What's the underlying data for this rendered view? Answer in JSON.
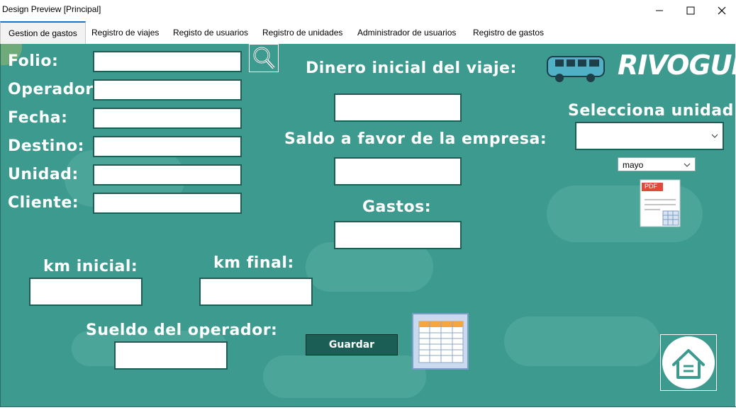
{
  "window": {
    "title": "Design Preview [Principal]"
  },
  "tabs": [
    {
      "label": "Gestion de gastos"
    },
    {
      "label": "Registro de viajes"
    },
    {
      "label": "Registo de usuarios"
    },
    {
      "label": "Registro de unidades"
    },
    {
      "label": "Administrador de usuarios"
    },
    {
      "label": "Registro de gastos"
    }
  ],
  "form": {
    "folio_label": "Folio:",
    "operador_label": "Operador:",
    "fecha_label": "Fecha:",
    "destino_label": "Destino:",
    "unidad_label": "Unidad:",
    "cliente_label": "Cliente:",
    "dinero_inicial_label": "Dinero inicial del viaje:",
    "saldo_label": "Saldo a favor de la empresa:",
    "gastos_label": "Gastos:",
    "km_inicial_label": "km inicial:",
    "km_final_label": "km final:",
    "sueldo_label": "Sueldo del operador:",
    "selecciona_unidad_label": "Selecciona unidad:",
    "unidad_select_value": "",
    "month_select_value": "mayo",
    "guardar_label": "Guardar"
  },
  "brand": {
    "logo_text": "RIVOGUE"
  },
  "pdf_icon_text": "PDF",
  "colors": {
    "panel": "#3d9a8e",
    "input_border": "#1d5f56",
    "button": "#1b5e55",
    "accent_tab": "#1a73c9"
  }
}
